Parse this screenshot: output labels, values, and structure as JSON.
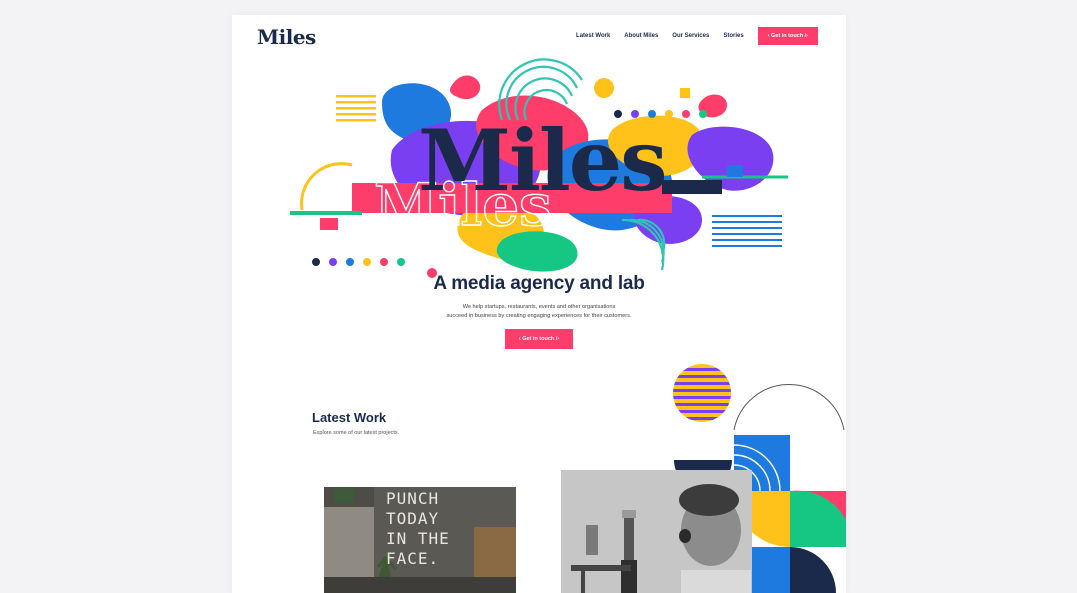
{
  "brand": {
    "logo": "Miles"
  },
  "nav": {
    "items": [
      "Latest Work",
      "About Miles",
      "Our Services",
      "Stories"
    ],
    "cta": "‹ Get in touch /›"
  },
  "hero": {
    "title": "Miles",
    "outline_title": "Miles",
    "tagline": "A media agency and lab",
    "description_line1": "We help startups, restaurants, events and other organisations",
    "description_line2": "succeed in business by creating engaging experiences for their customers.",
    "cta": "‹ Get in touch /›"
  },
  "latest_work": {
    "title": "Latest Work",
    "subtitle": "Explore some of our latest projects.",
    "project1_text": [
      "PUNCH",
      "TODAY",
      "IN THE",
      "FACE."
    ]
  },
  "colors": {
    "navy": "#1b2a4a",
    "pink": "#ff3d6a",
    "blue": "#1f7ae0",
    "purple": "#7b3ff2",
    "yellow": "#ffc21a",
    "green": "#16c784",
    "teal": "#2ec4b6",
    "orange": "#ff7a1a"
  }
}
